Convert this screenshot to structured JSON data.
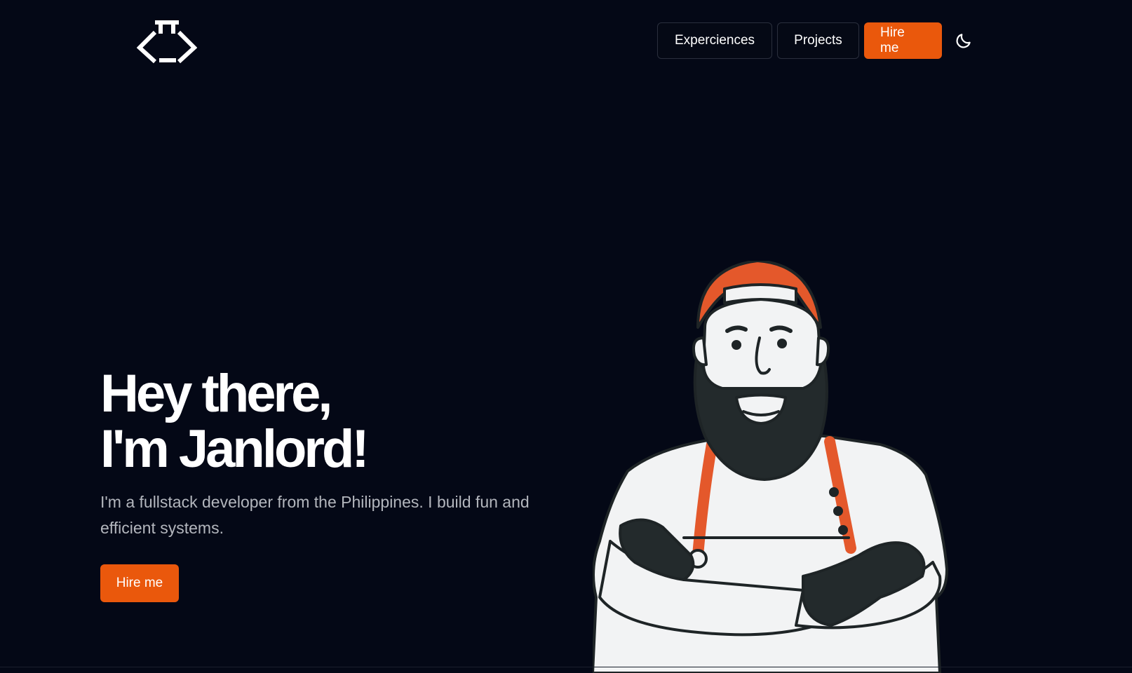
{
  "header": {
    "logo_name": "code-logo",
    "nav": [
      {
        "label": "Experciences"
      },
      {
        "label": "Projects"
      },
      {
        "label": "Hire me"
      }
    ],
    "theme_toggle_icon": "moon-icon"
  },
  "hero": {
    "title_line1": "Hey there,",
    "title_line2": "I'm Janlord!",
    "subtitle": "I'm a fullstack developer from the Philippines. I build fun and efficient systems.",
    "cta_label": "Hire me"
  },
  "colors": {
    "background": "#040816",
    "accent": "#ea580c",
    "text": "#ffffff",
    "muted": "#b3b6bd"
  }
}
